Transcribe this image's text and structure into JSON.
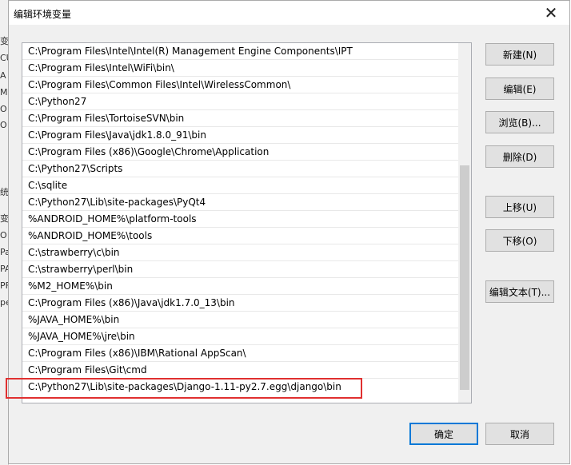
{
  "background_window": {
    "fragments": [
      "变",
      "CU",
      "A",
      "M",
      "O",
      "O",
      "统",
      "变",
      "O",
      "Pa",
      "PA",
      "PF",
      "pe"
    ]
  },
  "dialog": {
    "title": "编辑环境变量",
    "close_glyph": "✕"
  },
  "path_entries": [
    "C:\\Program Files\\Intel\\Intel(R) Management Engine Components\\IPT",
    "C:\\Program Files\\Intel\\WiFi\\bin\\",
    "C:\\Program Files\\Common Files\\Intel\\WirelessCommon\\",
    "C:\\Python27",
    "C:\\Program Files\\TortoiseSVN\\bin",
    "C:\\Program Files\\Java\\jdk1.8.0_91\\bin",
    "C:\\Program Files (x86)\\Google\\Chrome\\Application",
    "C:\\Python27\\Scripts",
    "C:\\sqlite",
    "C:\\Python27\\Lib\\site-packages\\PyQt4",
    "%ANDROID_HOME%\\platform-tools",
    "%ANDROID_HOME%\\tools",
    "C:\\strawberry\\c\\bin",
    "C:\\strawberry\\perl\\bin",
    "%M2_HOME%\\bin",
    "C:\\Program Files (x86)\\Java\\jdk1.7.0_13\\bin",
    "%JAVA_HOME%\\bin",
    "%JAVA_HOME%\\jre\\bin",
    "C:\\Program Files (x86)\\IBM\\Rational AppScan\\",
    "C:\\Program Files\\Git\\cmd",
    "C:\\Python27\\Lib\\site-packages\\Django-1.11-py2.7.egg\\django\\bin"
  ],
  "buttons": {
    "new": "新建(N)",
    "edit": "编辑(E)",
    "browse": "浏览(B)...",
    "delete": "删除(D)",
    "move_up": "上移(U)",
    "move_down": "下移(O)",
    "edit_text": "编辑文本(T)...",
    "ok": "确定",
    "cancel": "取消"
  },
  "colors": {
    "highlight_border": "#e03030",
    "default_button_border": "#0078d7"
  }
}
